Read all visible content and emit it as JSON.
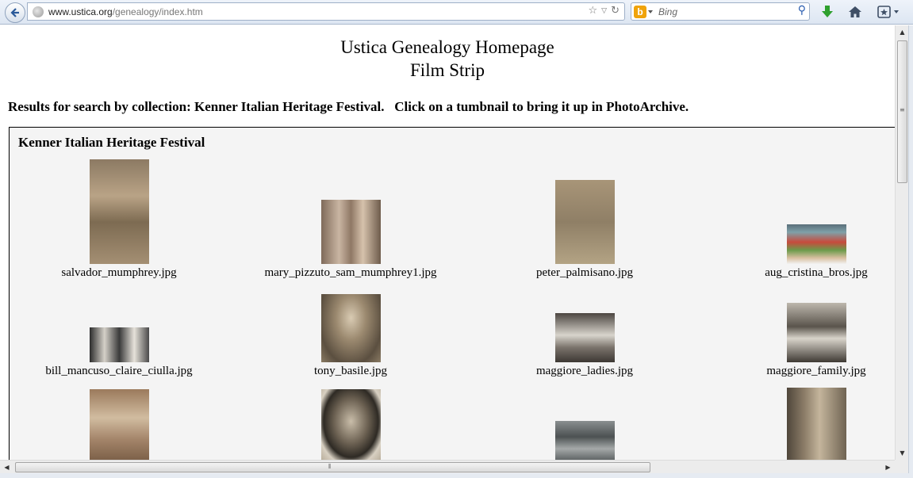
{
  "browser": {
    "url_host": "www.ustica.org",
    "url_path": "/genealogy/index.htm",
    "search_placeholder": "Bing",
    "icons": [
      "back-icon",
      "globe-icon",
      "star-icon",
      "dropdown-icon",
      "reload-icon",
      "bing-icon",
      "search-icon",
      "download-icon",
      "home-icon",
      "bookmarks-icon"
    ]
  },
  "page": {
    "title_line1": "Ustica Genealogy Homepage",
    "title_line2": "Film Strip",
    "results_text": "Results for search by collection: Kenner Italian Heritage Festival.   Click on a tumbnail to bring it up in PhotoArchive.",
    "collection_title": "Kenner Italian Heritage Festival"
  },
  "thumbnails": [
    {
      "caption": "salvador_mumphrey.jpg",
      "tone": "sepia-tall"
    },
    {
      "caption": "mary_pizzuto_sam_mumphrey1.jpg",
      "tone": "sepia-couple"
    },
    {
      "caption": "peter_palmisano.jpg",
      "tone": "faded-tall"
    },
    {
      "caption": "aug_cristina_bros.jpg",
      "tone": "color-label"
    },
    {
      "caption": "bill_mancuso_claire_ciulla.jpg",
      "tone": "bw-wide"
    },
    {
      "caption": "tony_basile.jpg",
      "tone": "sepia-portrait"
    },
    {
      "caption": "maggiore_ladies.jpg",
      "tone": "bw-group"
    },
    {
      "caption": "maggiore_family.jpg",
      "tone": "bw-family"
    },
    {
      "caption": "",
      "tone": "sepia-wedding"
    },
    {
      "caption": "",
      "tone": "oval-portrait"
    },
    {
      "caption": "",
      "tone": "bw-crowd"
    },
    {
      "caption": "",
      "tone": "sepia-doorway"
    }
  ],
  "scrollbars": {
    "vertical_position": 0.0,
    "horizontal_position": 0.0
  }
}
